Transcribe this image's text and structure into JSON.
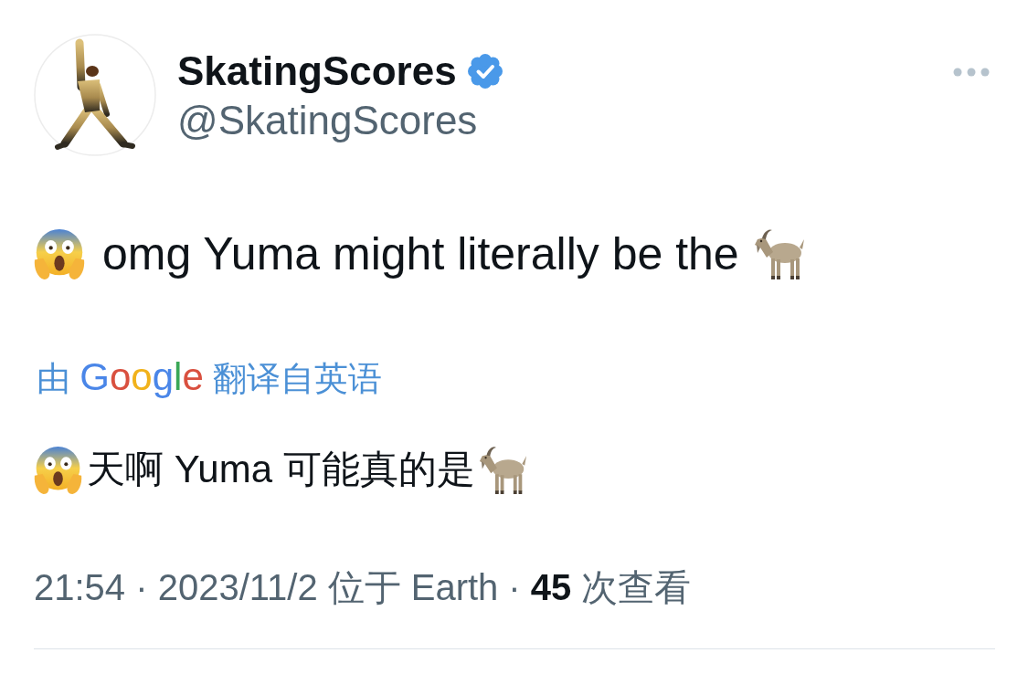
{
  "tweet": {
    "author": {
      "display_name": "SkatingScores",
      "handle": "@SkatingScores",
      "verified": true
    },
    "text": "omg Yuma might literally be the",
    "translation_credit": {
      "prefix": "由",
      "brand": "Google",
      "suffix": "翻译自英语"
    },
    "translated_text": "天啊 Yuma 可能真的是",
    "meta": {
      "timestamp": "21:54 · 2023/11/2",
      "location": "位于 Earth",
      "separator": "·",
      "views": "**45** 次查看"
    }
  }
}
